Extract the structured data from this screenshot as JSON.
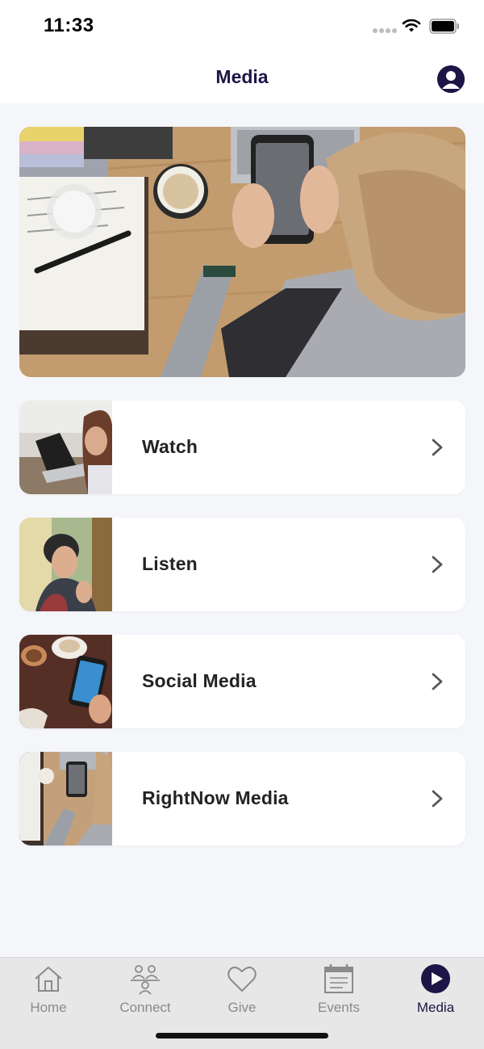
{
  "status_bar": {
    "time": "11:33"
  },
  "header": {
    "title": "Media",
    "profile_icon": "person-circle-icon"
  },
  "hero": {
    "image": "person-using-phone-at-desk-photo"
  },
  "media_items": [
    {
      "label": "Watch",
      "thumbnail": "woman-with-laptop-photo"
    },
    {
      "label": "Listen",
      "thumbnail": "woman-with-earphones-photo"
    },
    {
      "label": "Social Media",
      "thumbnail": "phone-with-coffee-photo"
    },
    {
      "label": "RightNow Media",
      "thumbnail": "person-using-phone-at-desk-photo"
    }
  ],
  "tab_bar": {
    "active": "Media",
    "tabs": [
      {
        "label": "Home",
        "icon": "home-icon"
      },
      {
        "label": "Connect",
        "icon": "people-icon"
      },
      {
        "label": "Give",
        "icon": "heart-icon"
      },
      {
        "label": "Events",
        "icon": "calendar-icon"
      },
      {
        "label": "Media",
        "icon": "play-circle-icon"
      }
    ]
  },
  "colors": {
    "brand": "#1c1546",
    "background": "#f4f6fa",
    "inactive_tab": "#8a8a8a"
  }
}
